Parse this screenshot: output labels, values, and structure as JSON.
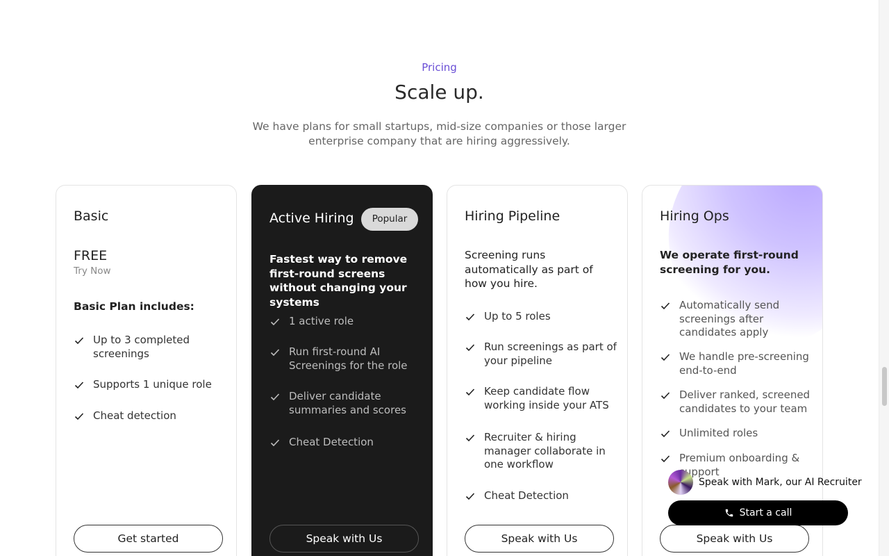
{
  "section": {
    "eyebrow": "Pricing",
    "title": "Scale up.",
    "subtitle": "We have plans for small startups, mid-size companies or those larger enterprise company that are hiring aggressively."
  },
  "plans": [
    {
      "name": "Basic",
      "price": "FREE",
      "price_note": "Try Now",
      "includes_label": "Basic Plan includes:",
      "features": [
        "Up to 3 completed screenings",
        "Supports 1 unique role",
        "Cheat detection"
      ],
      "cta": "Get started"
    },
    {
      "name": "Active Hiring",
      "badge": "Popular",
      "lead": "Fastest way to remove first-round screens without changing your systems",
      "features": [
        "1 active role",
        "Run first-round AI Screenings for the role",
        "Deliver candidate summaries and scores",
        "Cheat Detection"
      ],
      "cta": "Speak with Us"
    },
    {
      "name": "Hiring Pipeline",
      "lead": "Screening runs automatically as part of how you hire.",
      "features": [
        "Up to 5 roles",
        "Run screenings as part of your pipeline",
        "Keep candidate flow working inside your ATS",
        "Recruiter & hiring manager collaborate in one workflow",
        "Cheat Detection"
      ],
      "cta": "Speak with Us"
    },
    {
      "name": "Hiring Ops",
      "lead": "We operate first-round screening for you.",
      "features": [
        "Automatically send screenings after candidates apply",
        "We handle pre-screening end-to-end",
        "Deliver ranked, screened candidates to your team",
        "Unlimited roles",
        "Premium onboarding & support"
      ],
      "cta": "Speak with Us"
    }
  ],
  "widget": {
    "label": "Speak with Mark, our AI Recruiter",
    "button": "Start a call",
    "icon": "phone-icon"
  },
  "colors": {
    "accent": "#6a4fd6",
    "dark_card": "#1b1b1b",
    "call_button": "#000000"
  }
}
